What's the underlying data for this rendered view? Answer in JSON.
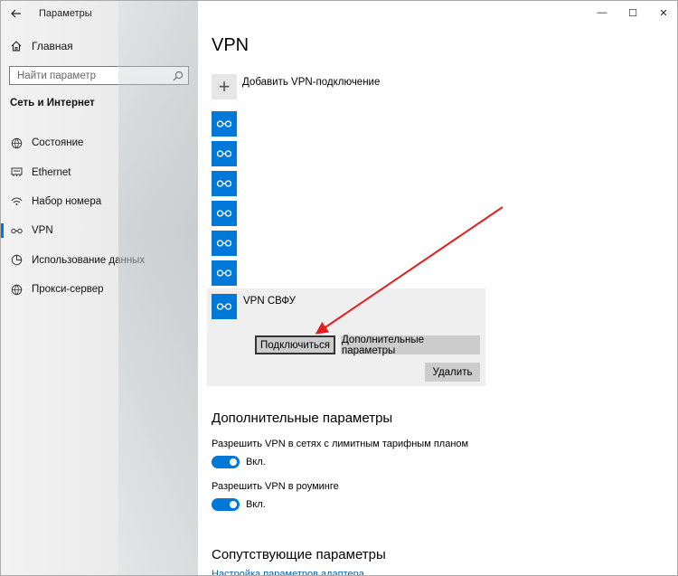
{
  "window": {
    "app_title": "Параметры",
    "back_icon": "back-arrow-icon",
    "controls": {
      "minimize": "—",
      "maximize": "☐",
      "close": "✕"
    }
  },
  "sidebar": {
    "home_label": "Главная",
    "search_placeholder": "Найти параметр",
    "section_label": "Сеть и Интернет",
    "items": [
      {
        "label": "Состояние",
        "icon": "globe-status-icon",
        "active": false
      },
      {
        "label": "Ethernet",
        "icon": "ethernet-icon",
        "active": false
      },
      {
        "label": "Набор номера",
        "icon": "dialup-icon",
        "active": false
      },
      {
        "label": "VPN",
        "icon": "vpn-icon",
        "active": true
      },
      {
        "label": "Использование данных",
        "icon": "data-usage-icon",
        "active": false
      },
      {
        "label": "Прокси-сервер",
        "icon": "globe-icon",
        "active": false
      }
    ]
  },
  "main": {
    "title": "VPN",
    "add_vpn_label": "Добавить VPN-подключение",
    "connections_unnamed_count": 6,
    "selected_connection": {
      "name": "VPN СВФУ",
      "connect_label": "Подключиться",
      "advanced_label": "Дополнительные параметры",
      "remove_label": "Удалить"
    },
    "advanced_section": {
      "heading": "Дополнительные параметры",
      "metered_label": "Разрешить VPN в сетях с лимитным тарифным планом",
      "metered_state": "Вкл.",
      "roaming_label": "Разрешить VPN в роуминге",
      "roaming_state": "Вкл."
    },
    "related_section": {
      "heading": "Сопутствующие параметры",
      "adapter_link": "Настройка параметров адаптера"
    }
  },
  "colors": {
    "accent": "#0078d7",
    "annotation_arrow": "#e0201e"
  }
}
